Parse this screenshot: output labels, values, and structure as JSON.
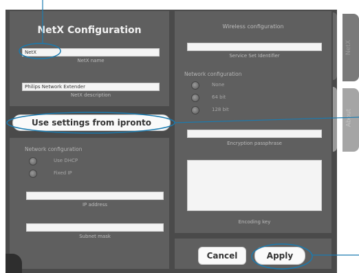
{
  "left": {
    "title": "NetX Configuration",
    "name_value": "NetX",
    "name_caption": "NetX name",
    "description_value": "Philips Network Extender",
    "description_caption": "NetX description",
    "use_settings_label": "Use settings from ipronto",
    "network_label": "Network configuration",
    "radio_dhcp": "Use DHCP",
    "radio_fixed": "Fixed IP",
    "ip_caption": "IP address",
    "subnet_caption": "Subnet mask"
  },
  "right": {
    "wireless_title": "Wireless configuration",
    "ssid_caption": "Service Set Identifier",
    "network_label": "Network configuration",
    "radio_none": "None",
    "radio_64": "64 bit",
    "radio_128": "128 bit",
    "passphrase_caption": "Encryption passphrase",
    "key_caption": "Encoding key"
  },
  "buttons": {
    "cancel": "Cancel",
    "apply": "Apply"
  },
  "tabs": {
    "netx": "NetX",
    "about": "About"
  },
  "colors": {
    "callout": "#1a7bb0",
    "screen_bg": "#4a4a4a"
  }
}
